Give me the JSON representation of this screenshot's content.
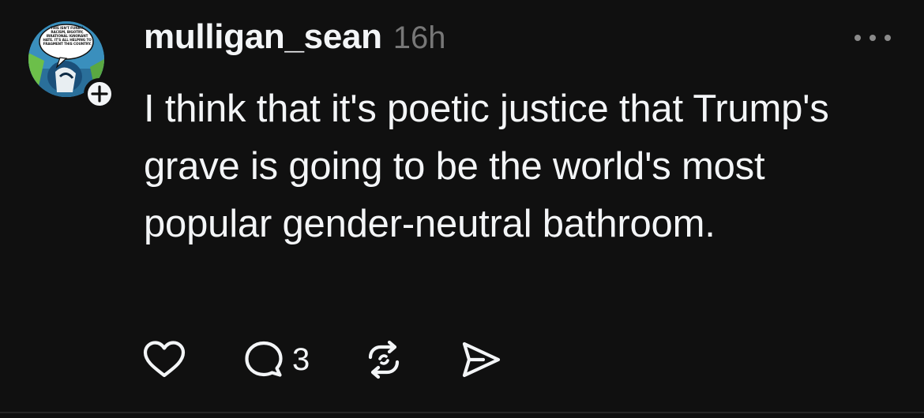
{
  "post": {
    "author": {
      "username": "mulligan_sean",
      "avatar_caption": "THIS ISN'T FUNNY. RACISM, BIGOTRY, IRRATIONAL IGNORANT HATE. IT'S ALL HELPING TO FRAGMENT THIS COUNTRY."
    },
    "timestamp": "16h",
    "body": "I think that it's poetic justice that Trump's grave is going to be the world's most popular gender-neutral bathroom.",
    "actions": {
      "reply_count": "3"
    }
  },
  "colors": {
    "background": "#101010",
    "text_primary": "#f3f5f7",
    "text_secondary": "#777777",
    "divider": "#262626"
  },
  "icons": [
    "plus-icon",
    "more-icon",
    "heart-icon",
    "comment-icon",
    "repost-icon",
    "share-icon"
  ]
}
